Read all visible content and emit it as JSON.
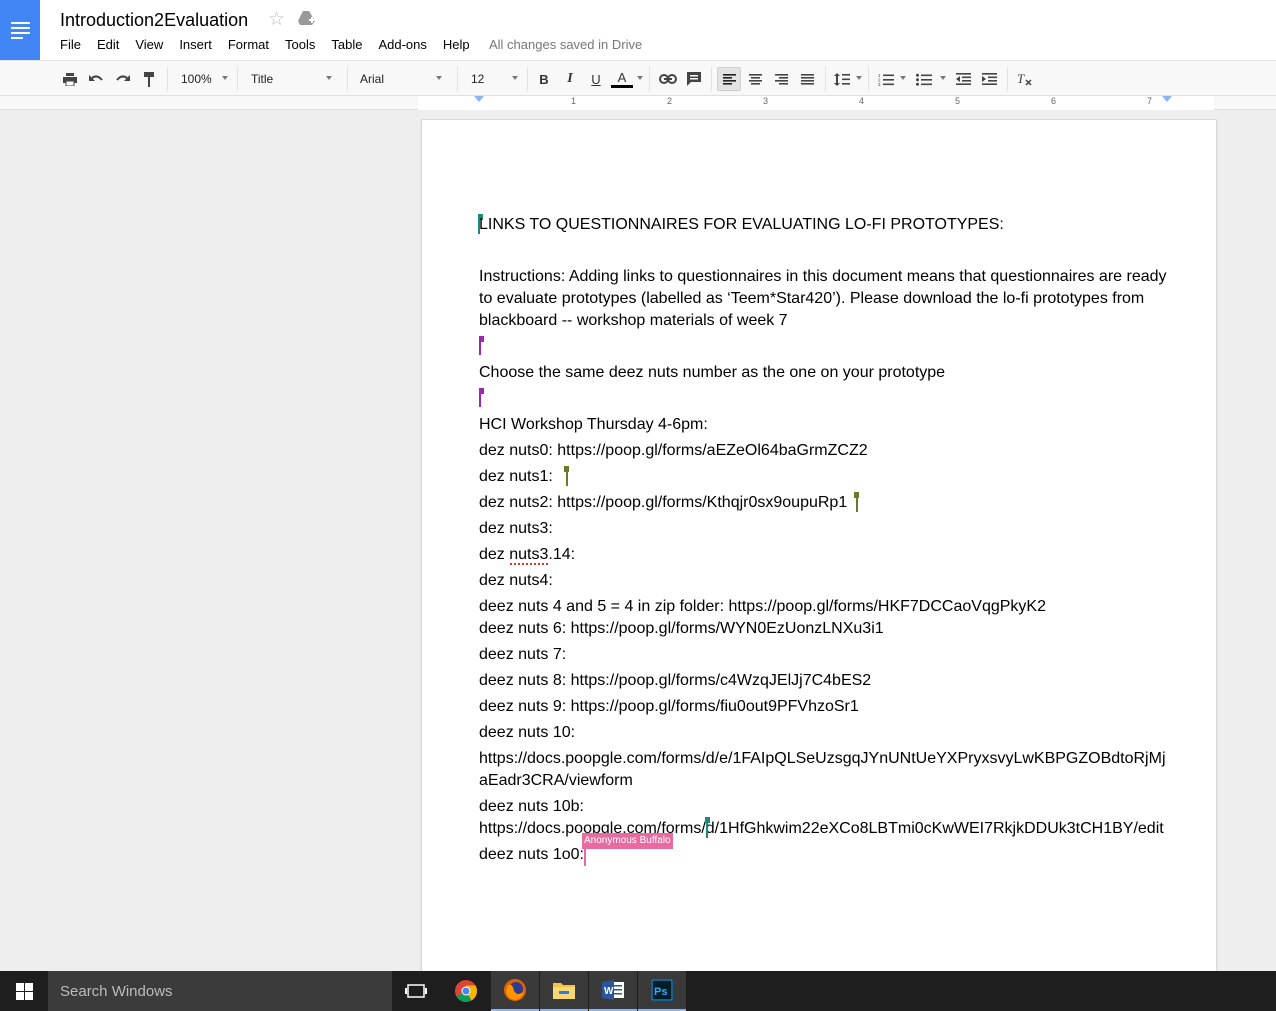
{
  "header": {
    "title": "Introduction2Evaluation",
    "saved_status": "All changes saved in Drive",
    "menu": [
      "File",
      "Edit",
      "View",
      "Insert",
      "Format",
      "Tools",
      "Table",
      "Add-ons",
      "Help"
    ]
  },
  "toolbar": {
    "zoom": "100%",
    "style": "Title",
    "font": "Arial",
    "size": "12"
  },
  "ruler": {
    "numbers": [
      "1",
      "2",
      "3",
      "4",
      "5",
      "6",
      "7"
    ]
  },
  "document": {
    "heading": "LINKS TO QUESTIONNAIRES FOR EVALUATING LO-FI PROTOTYPES:",
    "instructions": "Instructions: Adding links to questionnaires in this document means that questionnaires are ready to evaluate prototypes (labelled as ‘Teem*Star420’). Please download the lo-fi prototypes from blackboard -- workshop materials of week 7",
    "choose": "Choose the same deez nuts number as the one on your prototype",
    "workshop": "HCI Workshop Thursday 4-6pm:",
    "lines": [
      "dez nuts0: https://poop.gl/forms/aEZeOl64baGrmZCZ2",
      "dez nuts1:",
      "dez nuts2: https://poop.gl/forms/Kthqjr0sx9oupuRp1",
      "dez nuts3:",
      "dez nuts3.14:",
      "dez nuts4:",
      "deez nuts 4 and 5 = 4 in zip folder: https://poop.gl/forms/HKF7DCCaoVqgPkyK2",
      "deez nuts 6: https://poop.gl/forms/WYN0EzUonzLNXu3i1",
      "deez nuts 7:",
      "deez nuts 8: https://poop.gl/forms/c4WzqJElJj7C4bES2",
      "deez nuts 9: https://poop.gl/forms/fiu0out9PFVhzoSr1",
      "deez nuts 10:",
      "https://docs.poopgle.com/forms/d/e/1FAIpQLSeUzsgqJYnUNtUeYXPryxsvyLwKBPGZOBdtoRjMj",
      "aEadr3CRA/viewform",
      "deez nuts 10b:",
      "https://docs.poopgle.com/forms/d/1HfGhkwim22eXCo8LBTmi0cKwWEI7RkjkDDUk3tCH1BY/edit",
      "deez nuts 1o0:"
    ],
    "collaborator": "Anonymous Buffalo"
  },
  "taskbar": {
    "search_placeholder": "Search Windows"
  },
  "colors": {
    "brand": "#4285f4",
    "cursor_teal": "#1a8a7a",
    "cursor_purple": "#9c27b0",
    "cursor_olive": "#6b7a2a",
    "cursor_pink": "#e86aa0"
  }
}
